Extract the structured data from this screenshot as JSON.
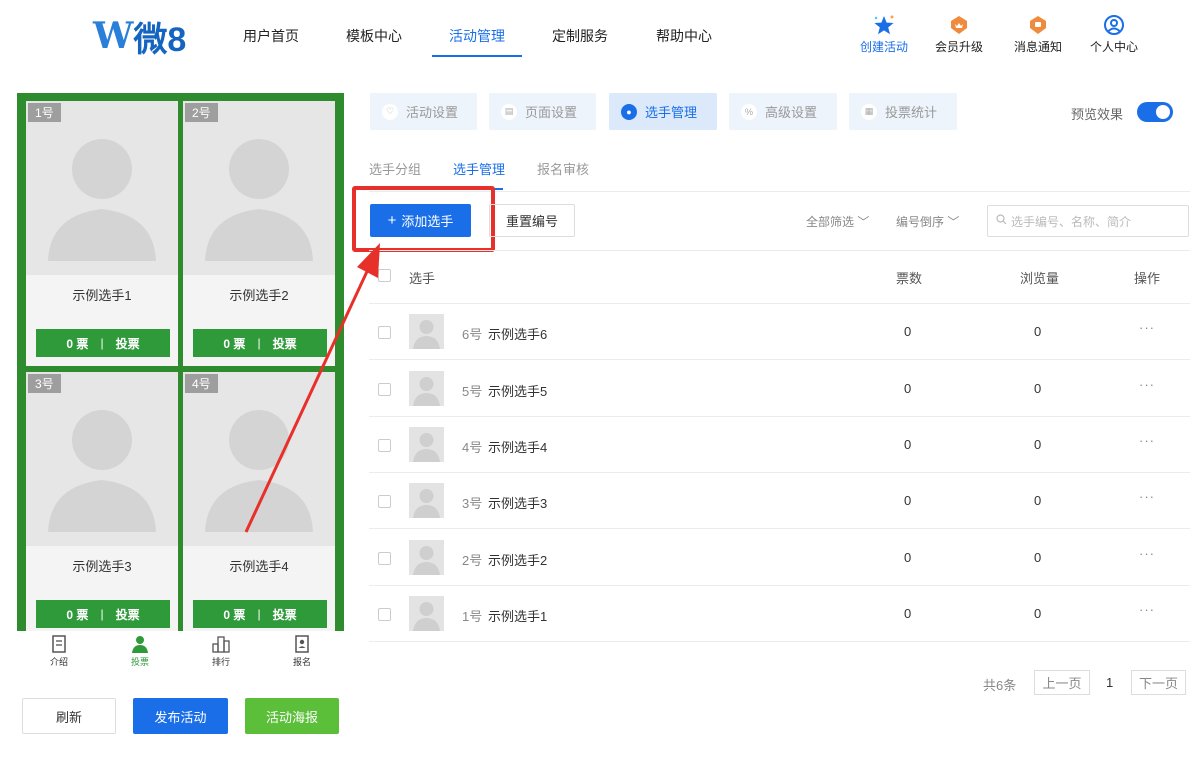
{
  "brand": {
    "logo_letter": "W",
    "logo_name": "微8"
  },
  "nav": {
    "items": [
      "用户首页",
      "模板中心",
      "活动管理",
      "定制服务",
      "帮助中心"
    ],
    "active_index": 2
  },
  "tools": [
    {
      "label": "创建活动",
      "icon": "star-icon"
    },
    {
      "label": "会员升级",
      "icon": "crown-badge-icon"
    },
    {
      "label": "消息通知",
      "icon": "notice-badge-icon"
    },
    {
      "label": "个人中心",
      "icon": "user-circle-icon"
    }
  ],
  "preview": {
    "cards": [
      {
        "num": "1号",
        "name": "示例选手1",
        "votes": "0 票",
        "vote_label": "投票"
      },
      {
        "num": "2号",
        "name": "示例选手2",
        "votes": "0 票",
        "vote_label": "投票"
      },
      {
        "num": "3号",
        "name": "示例选手3",
        "votes": "0 票",
        "vote_label": "投票"
      },
      {
        "num": "4号",
        "name": "示例选手4",
        "votes": "0 票",
        "vote_label": "投票"
      }
    ],
    "vote_sep": "|",
    "bottom_nav": [
      {
        "label": "介绍",
        "icon": "doc-icon"
      },
      {
        "label": "投票",
        "icon": "person-icon"
      },
      {
        "label": "排行",
        "icon": "bars-icon"
      },
      {
        "label": "报名",
        "icon": "signup-icon"
      }
    ],
    "bottom_nav_active": 1
  },
  "left_actions": {
    "refresh": "刷新",
    "publish": "发布活动",
    "poster": "活动海报"
  },
  "tabs": [
    {
      "label": "活动设置"
    },
    {
      "label": "页面设置"
    },
    {
      "label": "选手管理"
    },
    {
      "label": "高级设置"
    },
    {
      "label": "投票统计"
    }
  ],
  "tabs_active": 2,
  "preview_toggle": {
    "label": "预览效果",
    "on": true
  },
  "subtabs": [
    "选手分组",
    "选手管理",
    "报名审核"
  ],
  "subtabs_active": 1,
  "toolbar": {
    "add_label": "添加选手",
    "add_icon": "plus-icon",
    "reset_label": "重置编号",
    "filter_all": "全部筛选",
    "sort_label": "编号倒序",
    "search_placeholder": "选手编号、名称、简介"
  },
  "table": {
    "headers": {
      "player": "选手",
      "votes": "票数",
      "views": "浏览量",
      "ops": "操作"
    },
    "rows": [
      {
        "no": "6号",
        "name": "示例选手6",
        "votes": "0",
        "views": "0",
        "ops": "···"
      },
      {
        "no": "5号",
        "name": "示例选手5",
        "votes": "0",
        "views": "0",
        "ops": "···"
      },
      {
        "no": "4号",
        "name": "示例选手4",
        "votes": "0",
        "views": "0",
        "ops": "···"
      },
      {
        "no": "3号",
        "name": "示例选手3",
        "votes": "0",
        "views": "0",
        "ops": "···"
      },
      {
        "no": "2号",
        "name": "示例选手2",
        "votes": "0",
        "views": "0",
        "ops": "···"
      },
      {
        "no": "1号",
        "name": "示例选手1",
        "votes": "0",
        "views": "0",
        "ops": "···"
      }
    ]
  },
  "pager": {
    "total": "共6条",
    "prev": "上一页",
    "current": "1",
    "next": "下一页"
  },
  "colors": {
    "accent": "#1a6fe8",
    "vote_green": "#2f9a3a",
    "preview_bg": "#2e8b2e",
    "annotation_red": "#e8302a",
    "poster_green": "#5cbf3a"
  }
}
